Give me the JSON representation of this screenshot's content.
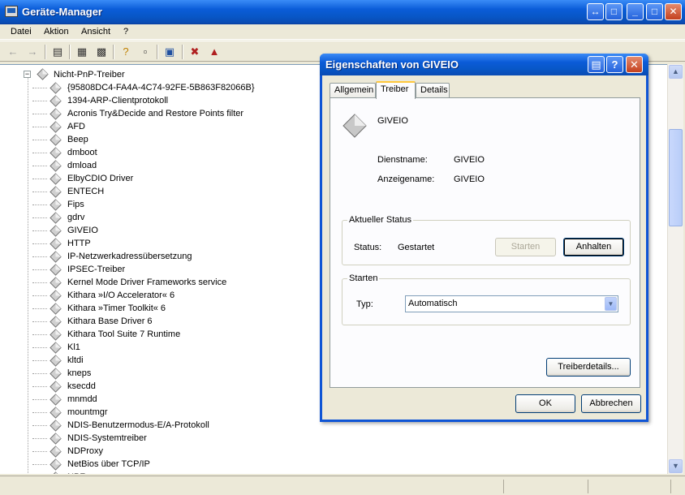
{
  "window": {
    "title": "Geräte-Manager"
  },
  "menu": [
    "Datei",
    "Aktion",
    "Ansicht",
    "?"
  ],
  "tree": {
    "root_label": "Nicht-PnP-Treiber",
    "items": [
      "{95808DC4-FA4A-4C74-92FE-5B863F82066B}",
      "1394-ARP-Clientprotokoll",
      "Acronis Try&Decide and Restore Points filter",
      "AFD",
      "Beep",
      "dmboot",
      "dmload",
      "ElbyCDIO Driver",
      "ENTECH",
      "Fips",
      "gdrv",
      "GIVEIO",
      "HTTP",
      "IP-Netzwerkadressübersetzung",
      "IPSEC-Treiber",
      "Kernel Mode Driver Frameworks service",
      "Kithara »I/O Accelerator« 6",
      "Kithara »Timer Toolkit« 6",
      "Kithara Base Driver 6",
      "Kithara Tool Suite 7 Runtime",
      "Kl1",
      "kltdi",
      "kneps",
      "ksecdd",
      "mnmdd",
      "mountmgr",
      "NDIS-Benutzermodus-E/A-Protokoll",
      "NDIS-Systemtreiber",
      "NDProxy",
      "NetBios über TCP/IP",
      "NPF"
    ]
  },
  "dialog": {
    "title": "Eigenschaften von GIVEIO",
    "tabs": [
      "Allgemein",
      "Treiber",
      "Details"
    ],
    "active_tab": "Treiber",
    "driver_name": "GIVEIO",
    "service_name_label": "Dienstname:",
    "service_name_value": "GIVEIO",
    "display_name_label": "Anzeigename:",
    "display_name_value": "GIVEIO",
    "status_group_title": "Aktueller Status",
    "status_label": "Status:",
    "status_value": "Gestartet",
    "start_button": "Starten",
    "stop_button": "Anhalten",
    "start_group_title": "Starten",
    "type_label": "Typ:",
    "type_value": "Automatisch",
    "driver_details_button": "Treiberdetails...",
    "ok_button": "OK",
    "cancel_button": "Abbrechen"
  }
}
